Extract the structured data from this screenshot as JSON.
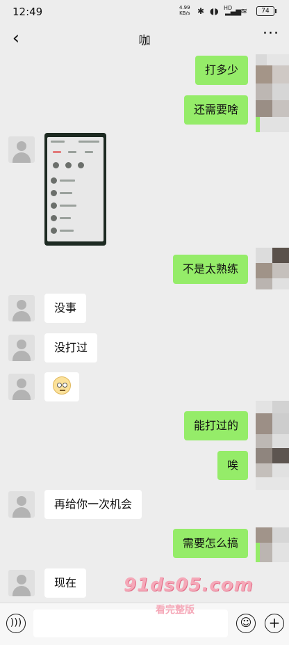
{
  "status_bar": {
    "time": "12:49",
    "net_speed": "4.99",
    "net_unit": "KB/s",
    "hd": "HD",
    "battery": "74"
  },
  "header": {
    "back_icon": "back-arrow-icon",
    "title": "咖",
    "more_icon": "more-dots-icon"
  },
  "messages": [
    {
      "side": "right",
      "type": "text",
      "text": "打多少"
    },
    {
      "side": "right",
      "type": "text",
      "text": "还需要啥"
    },
    {
      "side": "left",
      "type": "image",
      "text": ""
    },
    {
      "side": "right",
      "type": "text",
      "text": "不是太熟练"
    },
    {
      "side": "left",
      "type": "text",
      "text": "没事"
    },
    {
      "side": "left",
      "type": "text",
      "text": "没打过"
    },
    {
      "side": "left",
      "type": "emoji",
      "text": ""
    },
    {
      "side": "right",
      "type": "text",
      "text": "能打过的"
    },
    {
      "side": "right",
      "type": "text",
      "text": "唉"
    },
    {
      "side": "left",
      "type": "text",
      "text": "再给你一次机会"
    },
    {
      "side": "right",
      "type": "text",
      "text": "需要怎么搞"
    },
    {
      "side": "left",
      "type": "text",
      "text": "现在"
    }
  ],
  "watermark": {
    "domain": "91ds05.com",
    "caption": "看完整版"
  },
  "input_bar": {
    "voice_icon": "voice-icon",
    "emoji_icon": "emoji-icon",
    "plus_icon": "plus-icon"
  },
  "colors": {
    "background": "#ededed",
    "sent_bubble": "#95ec69",
    "received_bubble": "#ffffff"
  }
}
